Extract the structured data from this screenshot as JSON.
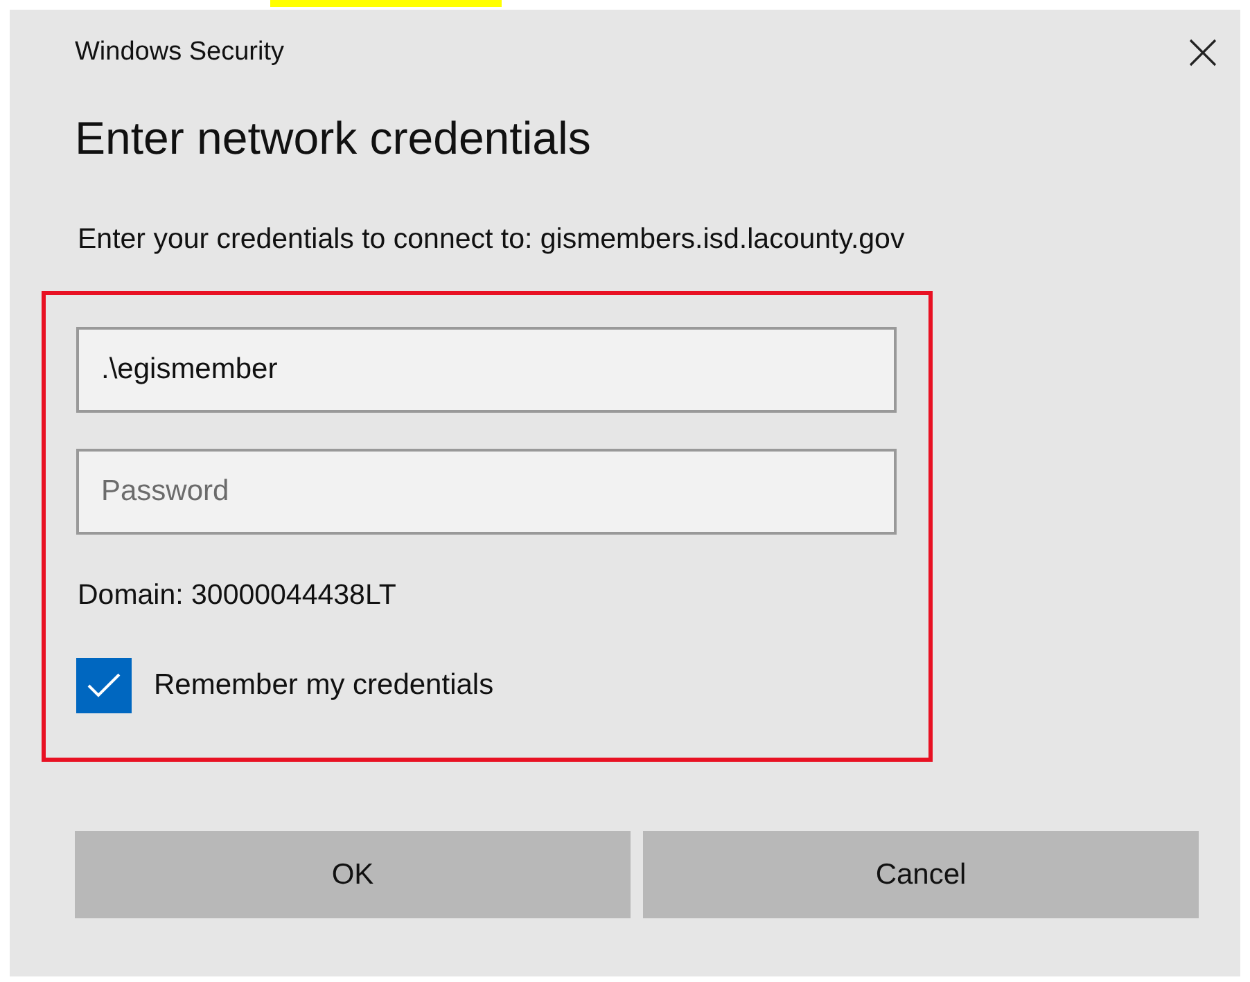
{
  "window": {
    "title": "Windows Security"
  },
  "heading": "Enter network credentials",
  "message": "Enter your credentials to connect to: gismembers.isd.lacounty.gov",
  "username": {
    "value": ".\\egismember"
  },
  "password": {
    "placeholder": "Password"
  },
  "domain": "Domain: 30000044438LT",
  "remember": {
    "label": "Remember my credentials",
    "checked": true
  },
  "buttons": [
    {
      "label": "OK"
    },
    {
      "label": "Cancel"
    }
  ]
}
